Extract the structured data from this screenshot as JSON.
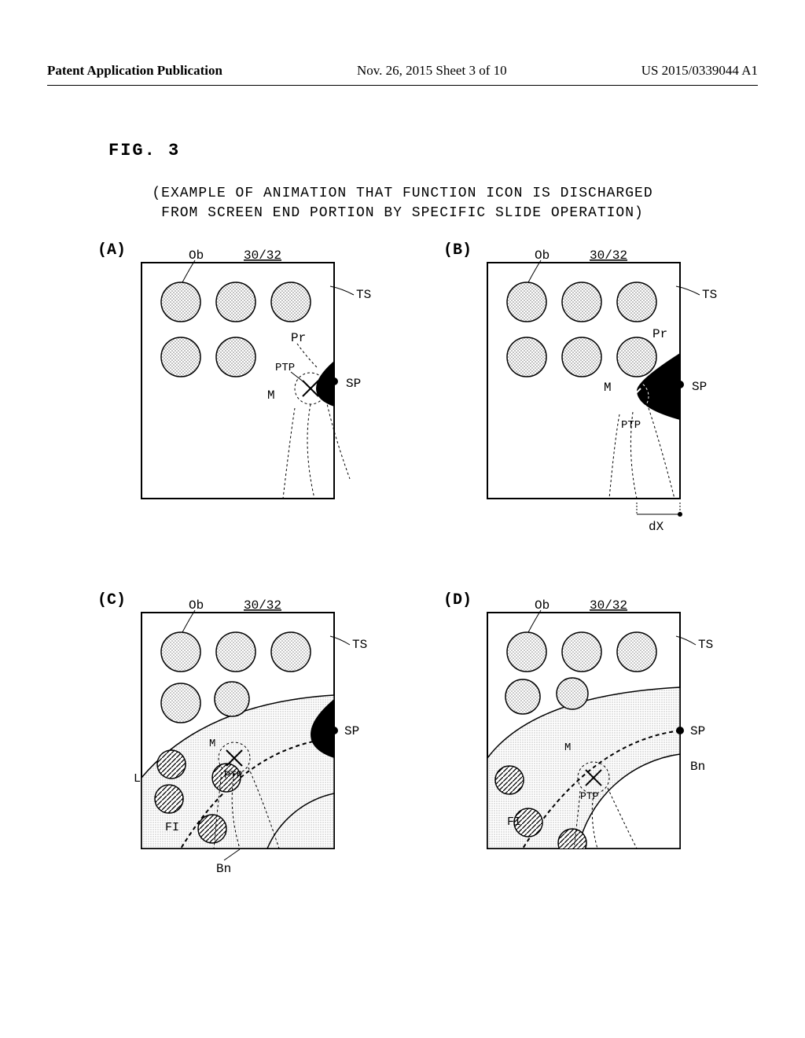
{
  "header": {
    "left": "Patent Application Publication",
    "center": "Nov. 26, 2015  Sheet 3 of 10",
    "right": "US 2015/0339044 A1"
  },
  "figure_label": "FIG. 3",
  "title_line1": "(EXAMPLE OF ANIMATION THAT FUNCTION ICON IS DISCHARGED",
  "title_line2": "FROM SCREEN END PORTION BY SPECIFIC SLIDE OPERATION)",
  "panels": {
    "A": {
      "label": "(A)",
      "Ob": "Ob",
      "ref3032": "30/32",
      "TS": "TS",
      "Pr": "Pr",
      "PTP": "PTP",
      "SP": "SP",
      "M": "M"
    },
    "B": {
      "label": "(B)",
      "Ob": "Ob",
      "ref3032": "30/32",
      "TS": "TS",
      "Pr": "Pr",
      "SP": "SP",
      "M": "M",
      "PTP": "PTP",
      "dX": "dX"
    },
    "C": {
      "label": "(C)",
      "Ob": "Ob",
      "ref3032": "30/32",
      "TS": "TS",
      "SP": "SP",
      "M": "M",
      "PTP": "PTP",
      "L": "L",
      "FI": "FI",
      "Bn": "Bn"
    },
    "D": {
      "label": "(D)",
      "Ob": "Ob",
      "ref3032": "30/32",
      "TS": "TS",
      "SP": "SP",
      "M": "M",
      "PTP": "PTP",
      "FI": "FI",
      "Bn": "Bn"
    }
  }
}
